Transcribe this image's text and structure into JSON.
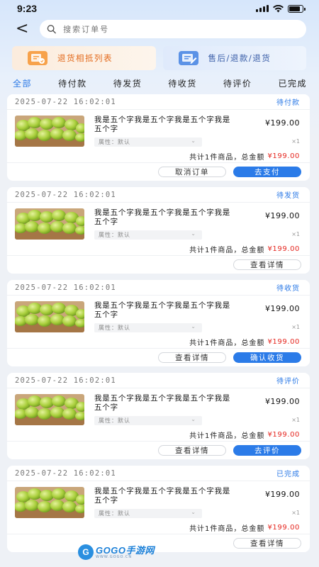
{
  "status_bar": {
    "time": "9:23",
    "battery_level": 0.85
  },
  "header": {
    "back_glyph": "<",
    "search_placeholder": "搜索订单号"
  },
  "features": [
    {
      "label": "退货相抵列表",
      "icon": "return-list-icon"
    },
    {
      "label": "售后/退款/退货",
      "icon": "after-sale-icon"
    }
  ],
  "tabs": [
    {
      "label": "全部",
      "active": true
    },
    {
      "label": "待付款",
      "active": false
    },
    {
      "label": "待发货",
      "active": false
    },
    {
      "label": "待收货",
      "active": false
    },
    {
      "label": "待评价",
      "active": false
    },
    {
      "label": "已完成",
      "active": false
    }
  ],
  "orders": [
    {
      "time": "2025-07-22 16:02:01",
      "status": "待付款",
      "title": "我是五个字我是五个字我是五个字我是五个字",
      "attr_label": "属性：",
      "attr_value": "默认",
      "price": "¥199.00",
      "qty": "×1",
      "total_prefix": "共计1件商品，总金额",
      "total_amount": "¥199.00",
      "buttons": [
        {
          "label": "取消订单",
          "style": "outline"
        },
        {
          "label": "去支付",
          "style": "primary"
        }
      ]
    },
    {
      "time": "2025-07-22 16:02:01",
      "status": "待发货",
      "title": "我是五个字我是五个字我是五个字我是五个字",
      "attr_label": "属性：",
      "attr_value": "默认",
      "price": "¥199.00",
      "qty": "×1",
      "total_prefix": "共计1件商品，总金额",
      "total_amount": "¥199.00",
      "buttons": [
        {
          "label": "查看详情",
          "style": "outline"
        }
      ]
    },
    {
      "time": "2025-07-22 16:02:01",
      "status": "待收货",
      "title": "我是五个字我是五个字我是五个字我是五个字",
      "attr_label": "属性：",
      "attr_value": "默认",
      "price": "¥199.00",
      "qty": "×1",
      "total_prefix": "共计1件商品，总金额",
      "total_amount": "¥199.00",
      "buttons": [
        {
          "label": "查看详情",
          "style": "outline"
        },
        {
          "label": "确认收货",
          "style": "primary"
        }
      ]
    },
    {
      "time": "2025-07-22 16:02:01",
      "status": "待评价",
      "title": "我是五个字我是五个字我是五个字我是五个字",
      "attr_label": "属性：",
      "attr_value": "默认",
      "price": "¥199.00",
      "qty": "×1",
      "total_prefix": "共计1件商品，总金额",
      "total_amount": "¥199.00",
      "buttons": [
        {
          "label": "查看详情",
          "style": "outline"
        },
        {
          "label": "去评价",
          "style": "primary"
        }
      ]
    },
    {
      "time": "2025-07-22 16:02:01",
      "status": "已完成",
      "title": "我是五个字我是五个字我是五个字我是五个字",
      "attr_label": "属性：",
      "attr_value": "默认",
      "price": "¥199.00",
      "qty": "×1",
      "total_prefix": "共计1件商品，总金额",
      "total_amount": "¥199.00",
      "buttons": [
        {
          "label": "查看详情",
          "style": "outline"
        }
      ]
    }
  ],
  "watermark": {
    "logo_letter": "G",
    "brand": "GOGO手游网",
    "url": "WWW.GOGO.CN"
  },
  "colors": {
    "accent": "#2b7be8",
    "price_red": "#e5261f",
    "returns_orange": "#e36a1c"
  }
}
